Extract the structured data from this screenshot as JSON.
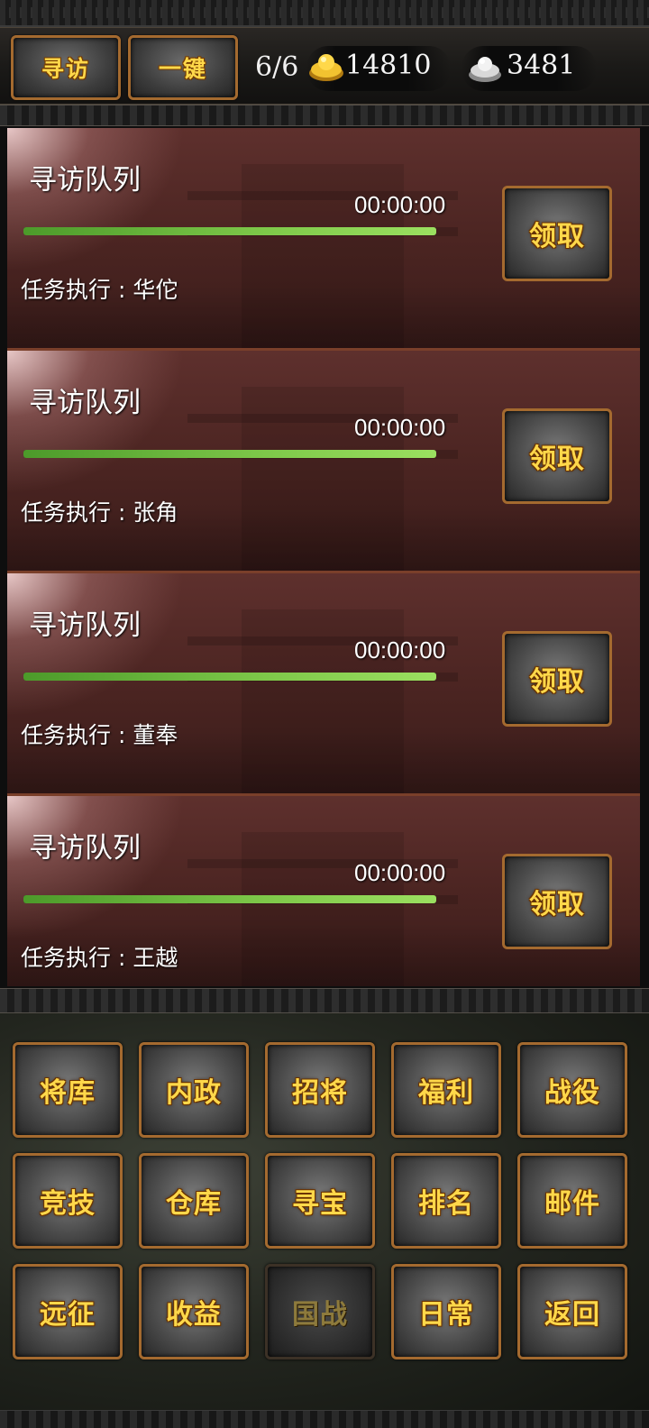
{
  "header": {
    "visit_button": "寻访",
    "one_click_button": "一键",
    "queue_count": "6/6",
    "gold": {
      "icon": "gold-ingot-icon",
      "value": "14810"
    },
    "silver": {
      "icon": "silver-ingot-icon",
      "value": "3481"
    }
  },
  "queues": [
    {
      "title": "寻访队列",
      "timer": "00:00:00",
      "progress": 1.0,
      "exec_label": "任务执行 : 华佗",
      "claim_label": "领取"
    },
    {
      "title": "寻访队列",
      "timer": "00:00:00",
      "progress": 1.0,
      "exec_label": "任务执行 : 张角",
      "claim_label": "领取"
    },
    {
      "title": "寻访队列",
      "timer": "00:00:00",
      "progress": 1.0,
      "exec_label": "任务执行 : 董奉",
      "claim_label": "领取"
    },
    {
      "title": "寻访队列",
      "timer": "00:00:00",
      "progress": 1.0,
      "exec_label": "任务执行 : 王越",
      "claim_label": "领取"
    }
  ],
  "nav": {
    "rows": [
      [
        "将库",
        "内政",
        "招将",
        "福利",
        "战役"
      ],
      [
        "竞技",
        "仓库",
        "寻宝",
        "排名",
        "邮件"
      ],
      [
        "远征",
        "收益",
        "国战",
        "日常",
        "返回"
      ]
    ],
    "disabled": [
      "国战"
    ]
  },
  "colors": {
    "gold_text": "#ffd84a",
    "button_border": "#a46a2f",
    "progress_fill": "#7fc94a",
    "card_bg": "#4c2522"
  }
}
